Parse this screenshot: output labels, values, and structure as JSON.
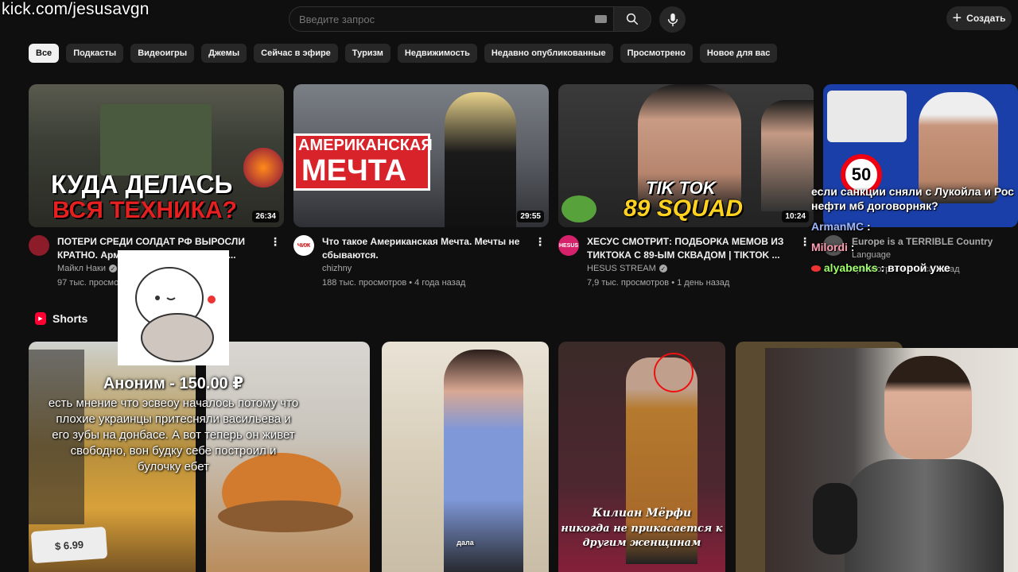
{
  "watermark": "kick.com/jesusavgn",
  "search": {
    "placeholder": "Введите запрос"
  },
  "header": {
    "create_label": "Создать"
  },
  "chips": [
    "Все",
    "Подкасты",
    "Видеоигры",
    "Джемы",
    "Сейчас в эфире",
    "Туризм",
    "Недвижимость",
    "Недавно опубликованные",
    "Просмотрено",
    "Новое для вас"
  ],
  "videos": [
    {
      "thumb_line1": "КУДА ДЕЛАСЬ",
      "thumb_line2": "ВСЯ ТЕХНИКА?",
      "duration": "26:34",
      "title": "ПОТЕРИ СРЕДИ СОЛДАТ РФ ВЫРОСЛИ КРАТНО. Армия в Африке не может ...",
      "channel": "Майкл Наки",
      "stats": "97 тыс. просмотров"
    },
    {
      "thumb_line1": "АМЕРИКАНСКАЯ",
      "thumb_line2": "МЕЧТА",
      "duration": "29:55",
      "title": "Что такое Американская Мечта. Мечты не сбываются.",
      "channel": "chizhny",
      "avatar_text": "ЧИЖ",
      "stats": "188 тыс. просмотров • 4 года назад"
    },
    {
      "thumb_line1": "TIK TOK",
      "thumb_line2": "89 SQUAD",
      "duration": "10:24",
      "title": "ХЕСУС СМОТРИТ: ПОДБОРКА МЕМОВ ИЗ ТИКТОКА С 89-ЫМ СКВАДОМ | TIKTOK ...",
      "channel": "HESUS STREAM",
      "avatar_text": "HESUS",
      "stats": "7,9 тыс. просмотров • 1 день назад"
    },
    {
      "thumb_sign": "50",
      "title": "Europe is a TERRIBLE Country",
      "channel": "Language",
      "stats": "просмотров • 3 часа назад"
    }
  ],
  "shorts": {
    "heading": "Shorts",
    "items": [
      {
        "price": "$ 6.99"
      },
      {},
      {
        "caption": "дала"
      },
      {
        "caption_line1": "Килиан Мёрфи",
        "caption_line2": "никогда не прикасается к",
        "caption_line3": "другим женщинам"
      }
    ]
  },
  "donation": {
    "title": "Аноним - 150.00 ₽",
    "text": "есть мнение что эсвеоу началось потому что плохие украинцы притесняли васильева и его зубы на донбасе. А вот теперь он живет свободно, вон будку себе построил и булочку ебет"
  },
  "chat": [
    {
      "name": "",
      "color": "#ffffff",
      "text": "если санкции сняли с Лукойла и Рос нефти мб договорняк?"
    },
    {
      "name": "ArmanMC",
      "color": "#9fb8ff",
      "text": ":"
    },
    {
      "name": "Milordi",
      "color": "#ff9db3",
      "text": ":"
    },
    {
      "name": "alyabenks",
      "color": "#9dff6a",
      "text": ": второй уже"
    }
  ]
}
